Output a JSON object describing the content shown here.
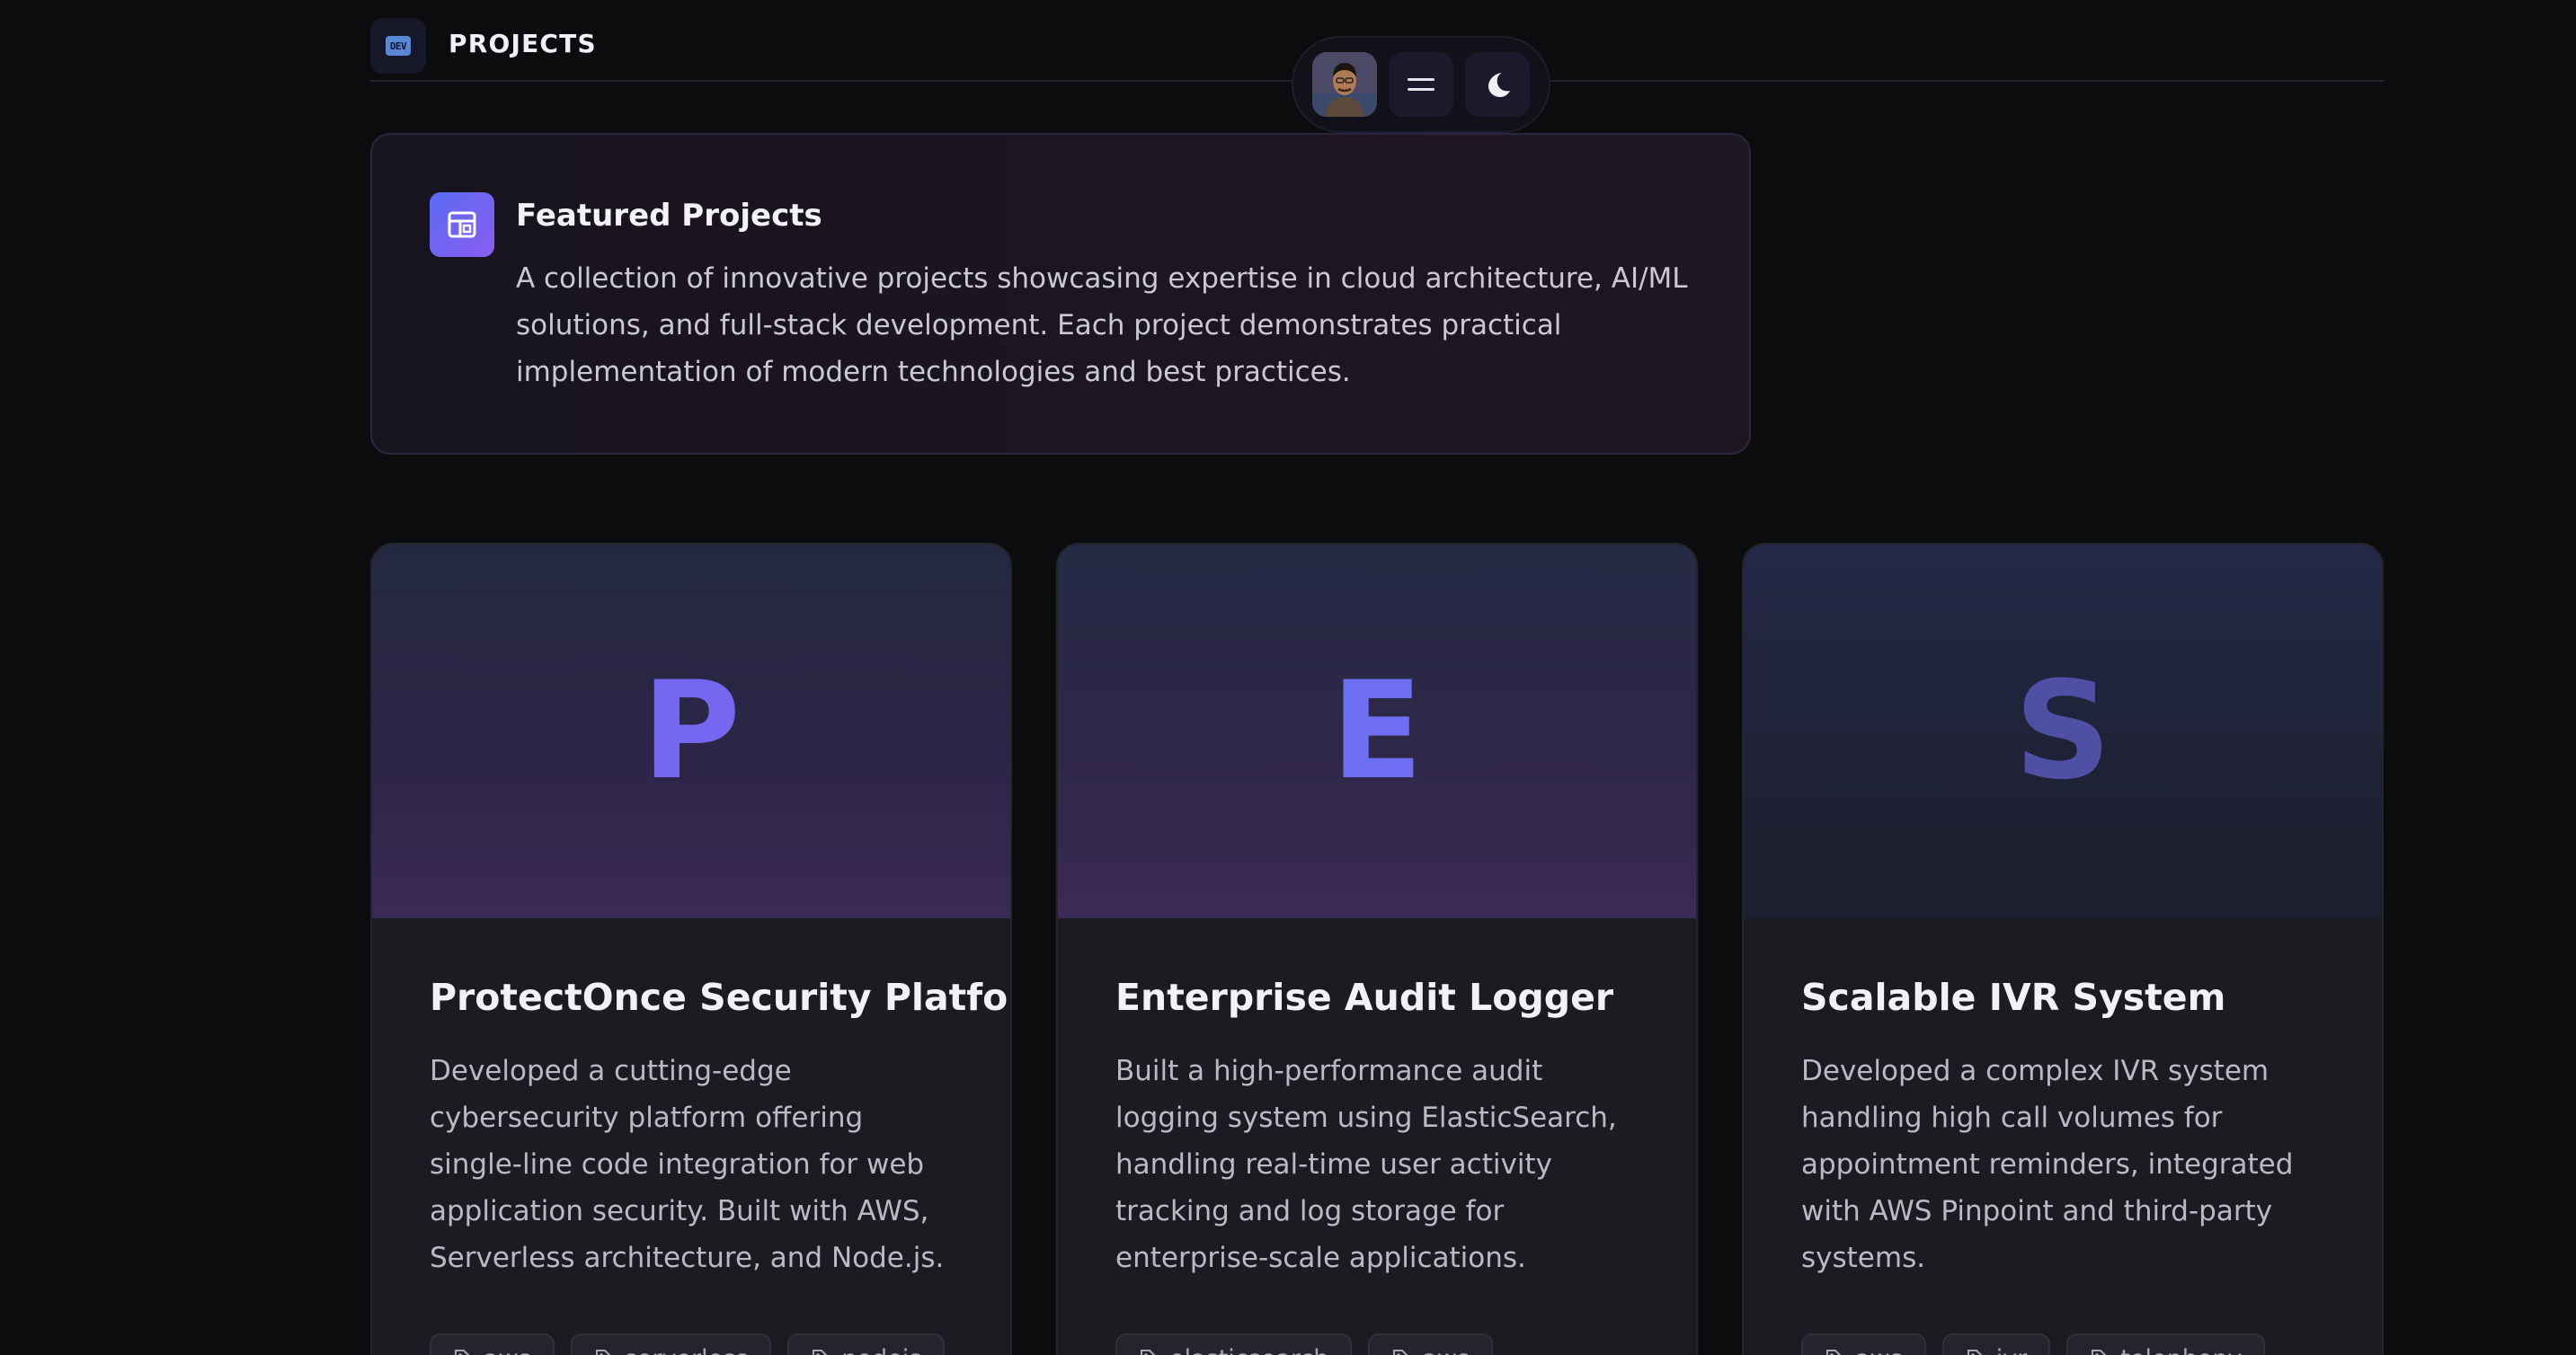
{
  "header": {
    "logo_text": "DEV",
    "title": "PROJECTS"
  },
  "dock": {
    "avatar_alt": "profile avatar",
    "menu_icon": "menu-icon",
    "theme_icon": "moon-icon"
  },
  "featured": {
    "icon": "layout-icon",
    "title": "Featured Projects",
    "description": "A collection of innovative projects showcasing expertise in cloud architecture, AI/ML solutions, and full-stack development. Each project demonstrates practical implementation of modern technologies and best practices."
  },
  "colors": {
    "accent_start": "#5a6cf2",
    "accent_end": "#8a5cf0",
    "background": "#0c0c0e",
    "card": "#1b1c22"
  },
  "projects": [
    {
      "letter": "P",
      "title": "ProtectOnce Security Platform",
      "description": "Developed a cutting-edge cybersecurity platform offering single-line code integration for web application security. Built with AWS, Serverless architecture, and Node.js.",
      "tags": [
        "aws",
        "serverless",
        "nodejs"
      ]
    },
    {
      "letter": "E",
      "title": "Enterprise Audit Logger",
      "description": "Built a high-performance audit logging system using ElasticSearch, handling real-time user activity tracking and log storage for enterprise-scale applications.",
      "tags": [
        "elasticsearch",
        "aws"
      ]
    },
    {
      "letter": "S",
      "title": "Scalable IVR System",
      "description": "Developed a complex IVR system handling high call volumes for appointment reminders, integrated with AWS Pinpoint and third-party systems.",
      "tags": [
        "aws",
        "ivr",
        "telephony"
      ]
    }
  ]
}
